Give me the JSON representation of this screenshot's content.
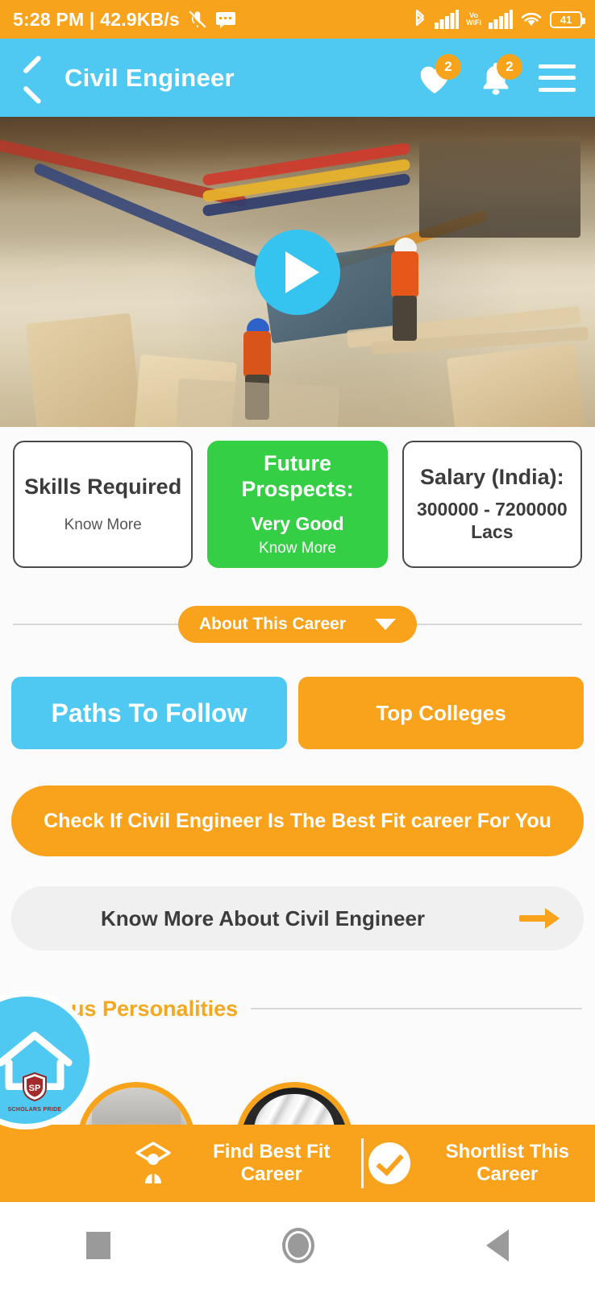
{
  "status_bar": {
    "time": "5:28 PM",
    "separator": "|",
    "network_speed": "42.9KB/s",
    "mute_icon": "mute-icon",
    "message_icon": "message-icon",
    "bluetooth_icon": "bluetooth-icon",
    "signal_icon": "signal-bars-icon",
    "volte_label_top": "Vo",
    "volte_label_bottom": "WiFi",
    "signal2_icon": "signal-bars-icon",
    "wifi_icon": "wifi-icon",
    "battery_level": "41"
  },
  "app_bar": {
    "back_icon": "back-chevron-icon",
    "title": "Civil Engineer",
    "favorites_icon": "heart-icon",
    "favorites_badge": "2",
    "notifications_icon": "bell-icon",
    "notifications_badge": "2",
    "menu_icon": "hamburger-menu-icon"
  },
  "hero": {
    "play_icon": "play-button-icon",
    "alt": "construction site video thumbnail"
  },
  "cards": [
    {
      "title": "Skills Required",
      "subtitle": "",
      "value": "",
      "link": "Know More",
      "style": "white"
    },
    {
      "title": "Future Prospects:",
      "subtitle": "Very Good",
      "value": "",
      "link": "Know More",
      "style": "green"
    },
    {
      "title": "Salary (India):",
      "subtitle": "",
      "value": "300000  - 7200000 Lacs",
      "link": "",
      "style": "white"
    }
  ],
  "about_section": {
    "label": "About This Career",
    "caret_icon": "chevron-down-icon"
  },
  "action_buttons": {
    "paths_to_follow": "Paths To Follow",
    "top_colleges": "Top Colleges",
    "best_fit": "Check If Civil Engineer Is The Best Fit career For You",
    "know_more": "Know More About Civil Engineer",
    "know_more_arrow_icon": "arrow-right-icon"
  },
  "famous_personalities": {
    "title": "Famous Personalities",
    "people": [
      {
        "name": "personality-1"
      },
      {
        "name": "personality-2"
      }
    ]
  },
  "bottom_bar": {
    "home_icon": "home-logo-icon",
    "home_crest_text": "SCHOLARS PRIDE",
    "find_best_fit": "Find Best Fit Career",
    "find_best_fit_icon": "graduate-icon",
    "shortlist": "Shortlist This Career",
    "shortlist_icon": "check-circle-icon"
  },
  "android_nav": {
    "recents_icon": "recents-square-icon",
    "home_icon": "home-circle-icon",
    "back_icon": "back-triangle-icon"
  },
  "colors": {
    "orange": "#F9A21B",
    "status_orange": "#F7A41C",
    "blue": "#4FC9F1",
    "green": "#35CF45",
    "light_gray": "#F0F0F0",
    "text_dark": "#3C3C3C"
  }
}
